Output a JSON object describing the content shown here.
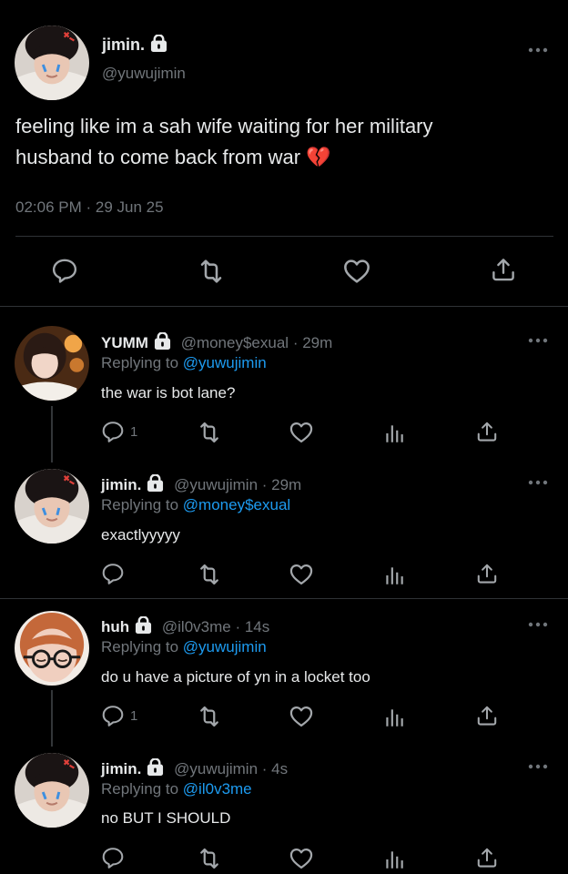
{
  "main": {
    "name": "jimin.",
    "handle": "@yuwujimin",
    "text_line1": "feeling like im a sah wife waiting for her military",
    "text_line2": "husband to come back from war",
    "emoji": "💔",
    "timestamp": "02:06 PM · 29 Jun 25"
  },
  "replies": [
    {
      "name": "YUMM",
      "handle": "@money$exual",
      "time": "· 29m",
      "replying_prefix": "Replying to",
      "replying_to": "@yuwujimin",
      "text": "the war is bot lane?",
      "reply_count": "1"
    },
    {
      "name": "jimin.",
      "handle": "@yuwujimin",
      "time": "· 29m",
      "replying_prefix": "Replying to",
      "replying_to": "@money$exual",
      "text": "exactlyyyyy",
      "reply_count": ""
    },
    {
      "name": "huh",
      "handle": "@il0v3me",
      "time": "· 14s",
      "replying_prefix": "Replying to",
      "replying_to": "@yuwujimin",
      "text": "do u have a picture of yn in a locket too",
      "reply_count": "1"
    },
    {
      "name": "jimin.",
      "handle": "@yuwujimin",
      "time": "· 4s",
      "replying_prefix": "Replying to",
      "replying_to": "@il0v3me",
      "text": "no BUT I SHOULD",
      "reply_count": ""
    }
  ],
  "colors": {
    "background": "#000000",
    "text": "#e7e9ea",
    "muted": "#71767b",
    "link": "#1d9bf0",
    "divider": "#2f3336"
  },
  "icons": [
    "lock-icon",
    "more-icon",
    "reply-icon",
    "retweet-icon",
    "like-icon",
    "views-icon",
    "share-icon",
    "broken-heart-emoji"
  ]
}
